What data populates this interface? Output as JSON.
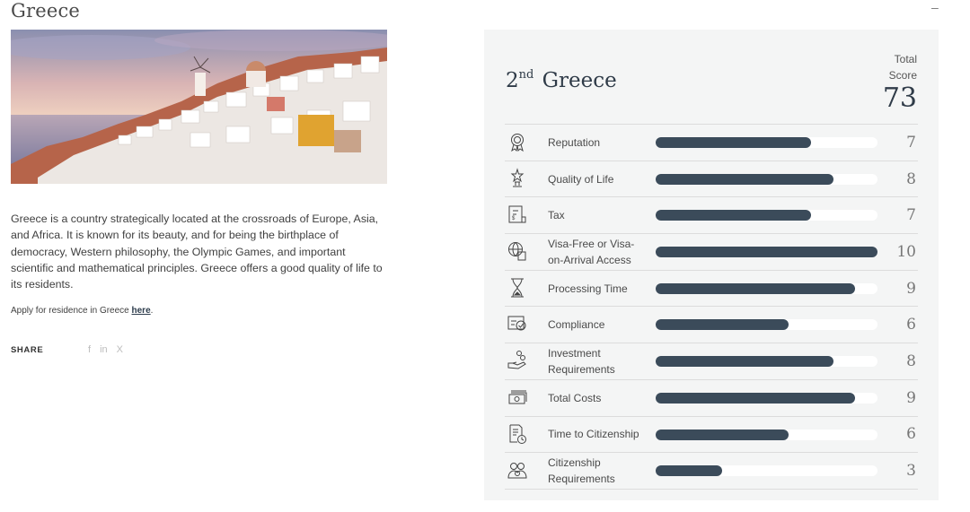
{
  "page": {
    "title": "Greece",
    "collapse_icon": "minus-icon"
  },
  "intro": {
    "description": "Greece is a country strategically located at the crossroads of Europe, Asia, and Africa. It is known for its beauty, and for being the birthplace of democracy, Western philosophy, the Olympic Games, and important scientific and mathematical principles. Greece offers a good quality of life to its residents.",
    "apply_prefix": "Apply for residence in Greece ",
    "apply_link": "here",
    "apply_suffix": ".",
    "share_label": "SHARE",
    "share_icons": [
      "facebook-icon",
      "linkedin-icon",
      "x-icon"
    ],
    "share_glyphs": [
      "f",
      "in",
      "X"
    ]
  },
  "scorecard": {
    "rank_number": "2",
    "rank_suffix": "nd",
    "country": "Greece",
    "total_label_1": "Total",
    "total_label_2": "Score",
    "total_score": "73",
    "max_score": 10,
    "bar_color": "#3b4b5a",
    "rows": [
      {
        "label": "Reputation",
        "value": 7,
        "icon": "award-badge-icon"
      },
      {
        "label": "Quality of Life",
        "value": 8,
        "icon": "trophy-icon"
      },
      {
        "label": "Tax",
        "value": 7,
        "icon": "tax-document-icon"
      },
      {
        "label": "Visa-Free or Visa-on-Arrival Access",
        "value": 10,
        "icon": "globe-passport-icon"
      },
      {
        "label": "Processing Time",
        "value": 9,
        "icon": "hourglass-icon"
      },
      {
        "label": "Compliance",
        "value": 6,
        "icon": "compliance-check-icon"
      },
      {
        "label": "Investment Requirements",
        "value": 8,
        "icon": "hand-coins-icon"
      },
      {
        "label": "Total Costs",
        "value": 9,
        "icon": "money-stack-icon"
      },
      {
        "label": "Time to Citizenship",
        "value": 6,
        "icon": "document-clock-icon"
      },
      {
        "label": "Citizenship Requirements",
        "value": 3,
        "icon": "people-group-icon"
      }
    ]
  }
}
